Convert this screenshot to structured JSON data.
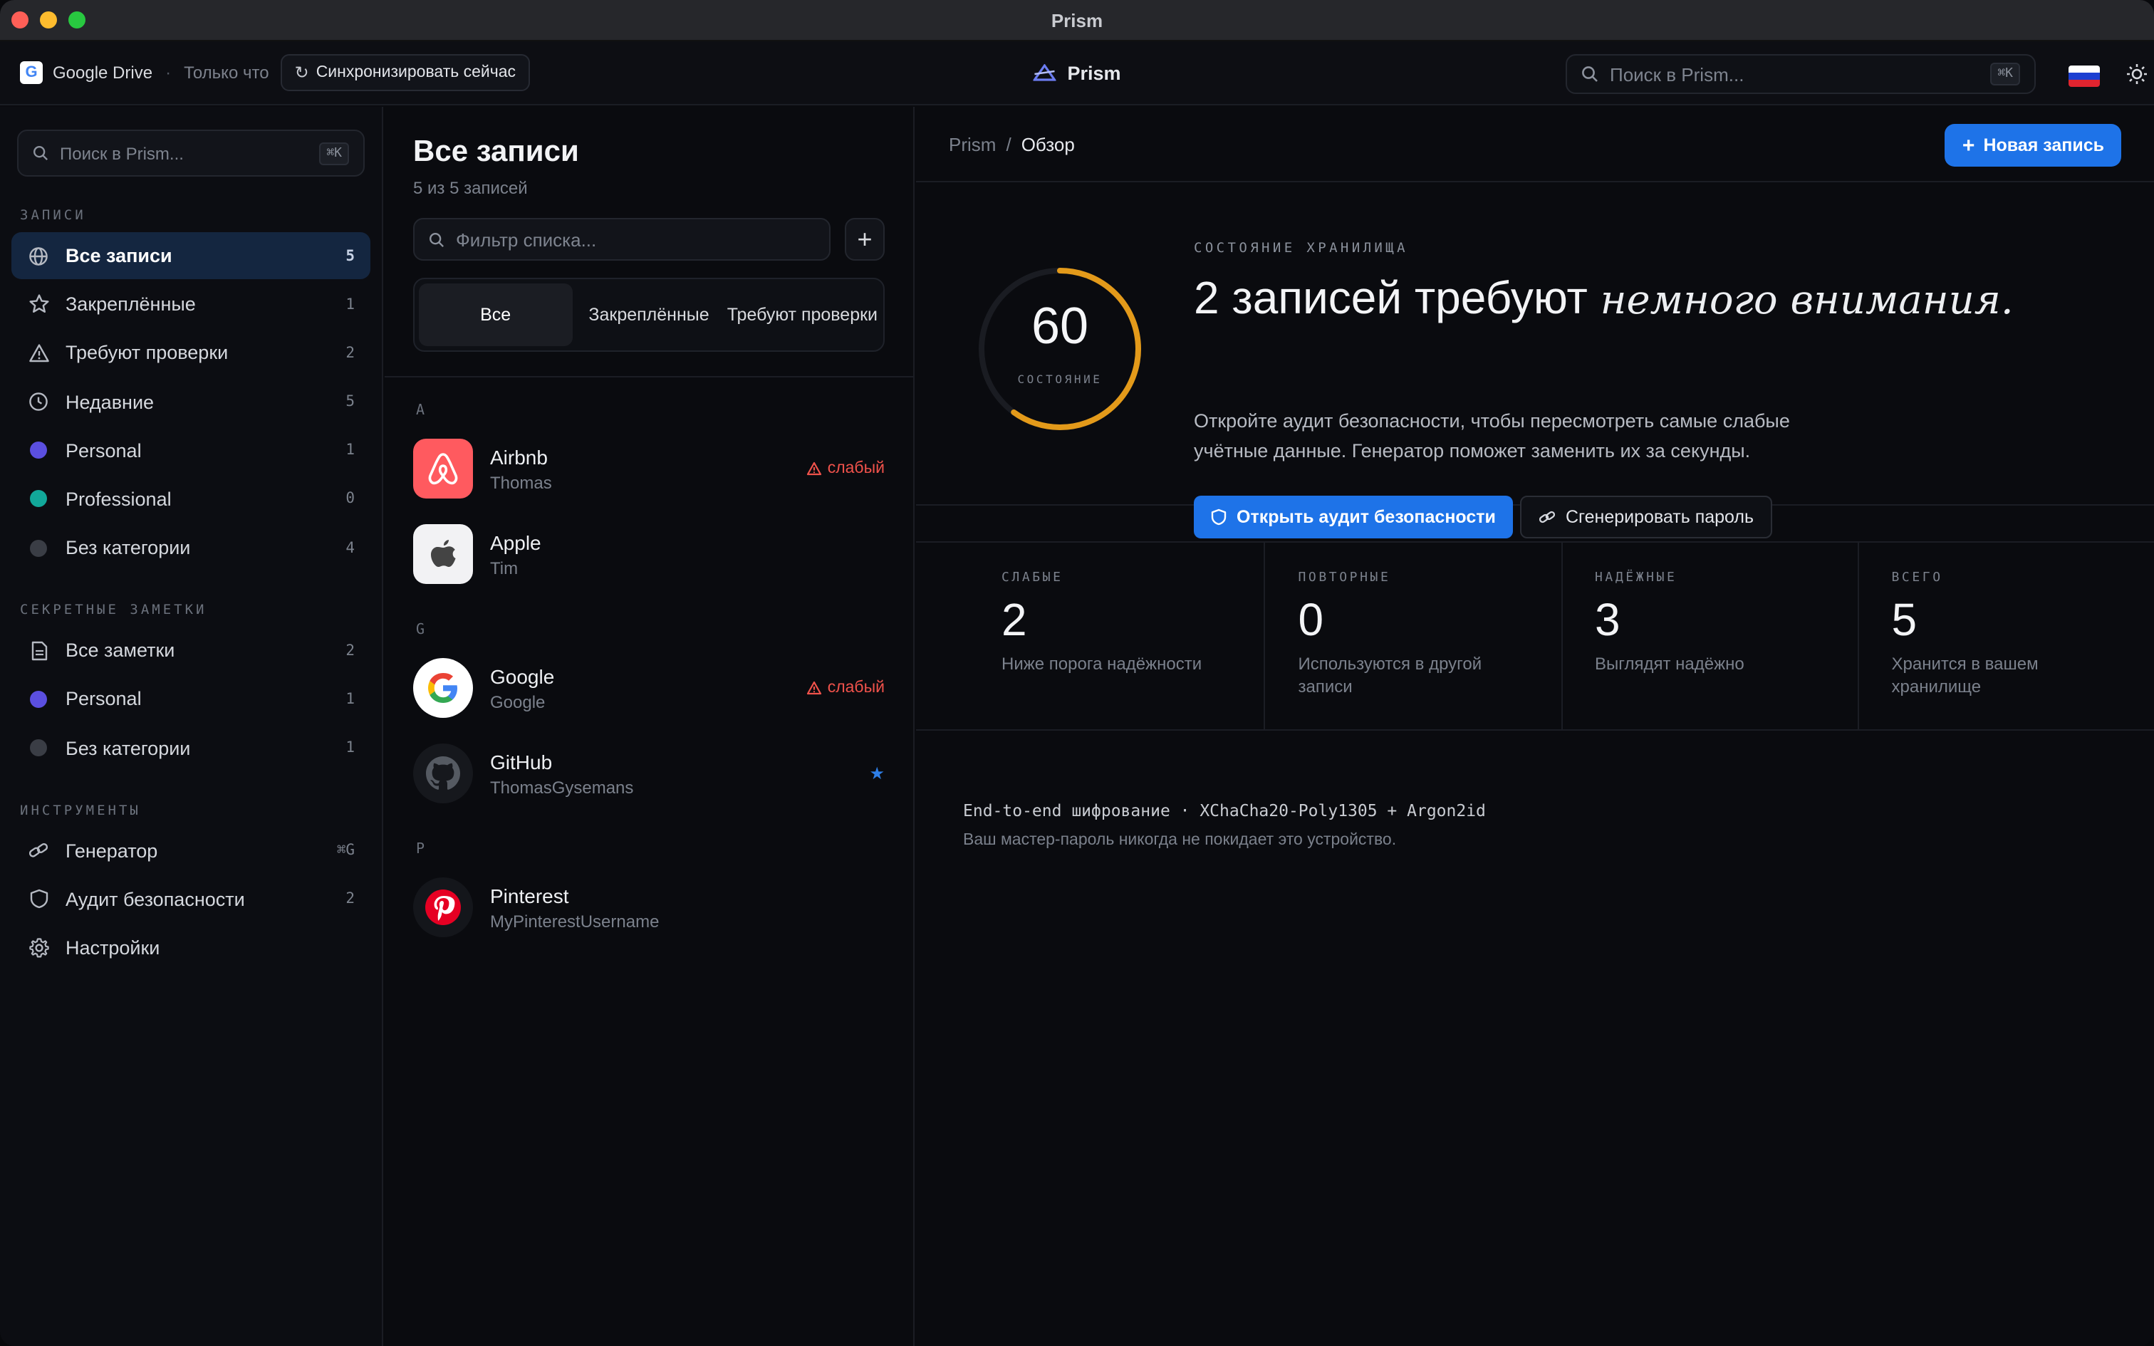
{
  "window": {
    "title": "Prism"
  },
  "header": {
    "drive_label": "Google Drive",
    "drive_badge": "G",
    "sync_status": "Только что",
    "sync_button": "Синхронизировать сейчас",
    "brand": "Prism",
    "search_placeholder": "Поиск в Prism...",
    "search_shortcut": "⌘K",
    "flag_colors": [
      "#ffffff",
      "#1c3fd1",
      "#e0242f"
    ]
  },
  "sidebar": {
    "search_placeholder": "Поиск в Prism...",
    "search_shortcut": "⌘K",
    "sections": {
      "records": "ЗАПИСИ",
      "notes": "СЕКРЕТНЫЕ ЗАМЕТКИ",
      "tools": "ИНСТРУМЕНТЫ"
    },
    "records": [
      {
        "label": "Все записи",
        "count": "5",
        "icon": "globe-icon"
      },
      {
        "label": "Закреплённые",
        "count": "1",
        "icon": "star-icon"
      },
      {
        "label": "Требуют проверки",
        "count": "2",
        "icon": "warning-icon"
      },
      {
        "label": "Недавние",
        "count": "5",
        "icon": "clock-icon"
      },
      {
        "label": "Personal",
        "count": "1",
        "color": "#5b4fe0"
      },
      {
        "label": "Professional",
        "count": "0",
        "color": "#12a89a"
      },
      {
        "label": "Без категории",
        "count": "4",
        "color": "#3a3d45"
      }
    ],
    "notes": [
      {
        "label": "Все заметки",
        "count": "2",
        "icon": "note-icon"
      },
      {
        "label": "Personal",
        "count": "1",
        "color": "#5b4fe0"
      },
      {
        "label": "Без категории",
        "count": "1",
        "color": "#3a3d45"
      }
    ],
    "tools": [
      {
        "label": "Генератор",
        "count": "⌘G",
        "icon": "link-icon"
      },
      {
        "label": "Аудит безопасности",
        "count": "2",
        "icon": "shield-icon"
      },
      {
        "label": "Настройки",
        "count": "",
        "icon": "gear-icon"
      }
    ]
  },
  "list": {
    "title": "Все записи",
    "subtitle": "5 из 5 записей",
    "filter_placeholder": "Фильтр списка...",
    "tabs": [
      "Все",
      "Закреплённые",
      "Требуют проверки"
    ],
    "groups": [
      {
        "letter": "A",
        "entries": [
          {
            "name": "Airbnb",
            "user": "Thomas",
            "badge": "слабый"
          },
          {
            "name": "Apple",
            "user": "Tim",
            "badge": ""
          }
        ]
      },
      {
        "letter": "G",
        "entries": [
          {
            "name": "Google",
            "user": "Google",
            "badge": "слабый"
          },
          {
            "name": "GitHub",
            "user": "ThomasGysemans",
            "pinned": true
          }
        ]
      },
      {
        "letter": "P",
        "entries": [
          {
            "name": "Pinterest",
            "user": "MyPinterestUsername",
            "badge": ""
          }
        ]
      }
    ]
  },
  "main": {
    "breadcrumb": [
      "Prism",
      "Обзор"
    ],
    "new_button": "Новая запись",
    "health": {
      "kicker": "СОСТОЯНИЕ ХРАНИЛИЩА",
      "score": "60",
      "score_fraction": 0.6,
      "score_label": "СОСТОЯНИЕ",
      "headline_plain": "2 записей требуют",
      "headline_italic": "немного внимания.",
      "desc_line1": "Откройте аудит безопасности, чтобы пересмотреть самые слабые",
      "desc_line2": "учётные данные. Генератор поможет заменить их за секунды.",
      "audit_button": "Открыть аудит безопасности",
      "generate_button": "Сгенерировать пароль",
      "ring_color": "#e39a1a"
    },
    "stats": [
      {
        "label": "СЛАБЫЕ",
        "value": "2",
        "note": "Ниже порога надёжности"
      },
      {
        "label": "ПОВТОРНЫЕ",
        "value": "0",
        "note": "Используются в другой записи"
      },
      {
        "label": "НАДЁЖНЫЕ",
        "value": "3",
        "note": "Выглядят надёжно"
      },
      {
        "label": "ВСЕГО",
        "value": "5",
        "note": "Хранится в вашем хранилище"
      }
    ],
    "encryption": "End-to-end шифрование · XChaCha20-Poly1305 + Argon2id",
    "encryption_note": "Ваш мастер-пароль никогда не покидает это устройство."
  }
}
